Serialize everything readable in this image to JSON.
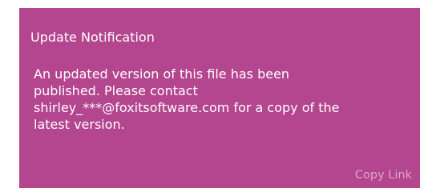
{
  "notification": {
    "title": "Update Notification",
    "message_lines": [
      "An updated version of this file has been",
      "published. Please contact",
      "shirley_***@foxitsoftware.com for a copy of the",
      "latest version."
    ],
    "copy_link_label": "Copy Link",
    "colors": {
      "background": "#b4458f",
      "text": "#ffffff",
      "link": "#dda6c9"
    }
  }
}
